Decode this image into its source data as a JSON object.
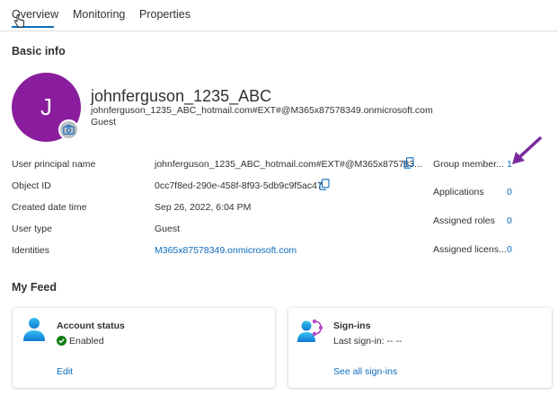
{
  "tabs": [
    {
      "label": "Overview",
      "selected": true
    },
    {
      "label": "Monitoring",
      "selected": false
    },
    {
      "label": "Properties",
      "selected": false
    }
  ],
  "basic_info": {
    "title": "Basic info",
    "avatar_initial": "J",
    "avatar_color": "#8a1d9d",
    "display_name": "johnferguson_1235_ABC",
    "upn": "johnferguson_1235_ABC_hotmail.com#EXT#@M365x87578349.onmicrosoft.com",
    "user_type": "Guest"
  },
  "properties": [
    {
      "label": "User principal name",
      "value": "johnferguson_1235_ABC_hotmail.com#EXT#@M365x875783...",
      "copy": true
    },
    {
      "label": "Object ID",
      "value": "0cc7f8ed-290e-458f-8f93-5db9c9f5ac47",
      "copy": true
    },
    {
      "label": "Created date time",
      "value": "Sep 26, 2022, 6:04 PM"
    },
    {
      "label": "User type",
      "value": "Guest"
    },
    {
      "label": "Identities",
      "value": "M365x87578349.onmicrosoft.com",
      "link": true
    }
  ],
  "stats": [
    {
      "label": "Group member...",
      "value": "1"
    },
    {
      "label": "Applications",
      "value": "0"
    },
    {
      "label": "Assigned roles",
      "value": "0"
    },
    {
      "label": "Assigned licens...",
      "value": "0"
    }
  ],
  "feed": {
    "title": "My Feed",
    "account_status": {
      "title": "Account status",
      "status": "Enabled",
      "link": "Edit"
    },
    "signins": {
      "title": "Sign-ins",
      "last": "Last sign-in: -- --",
      "link": "See all sign-ins"
    }
  },
  "colors": {
    "accent": "#0f6cbd",
    "enabled_green": "#107c10",
    "annotation_arrow": "#7a2a9e"
  }
}
